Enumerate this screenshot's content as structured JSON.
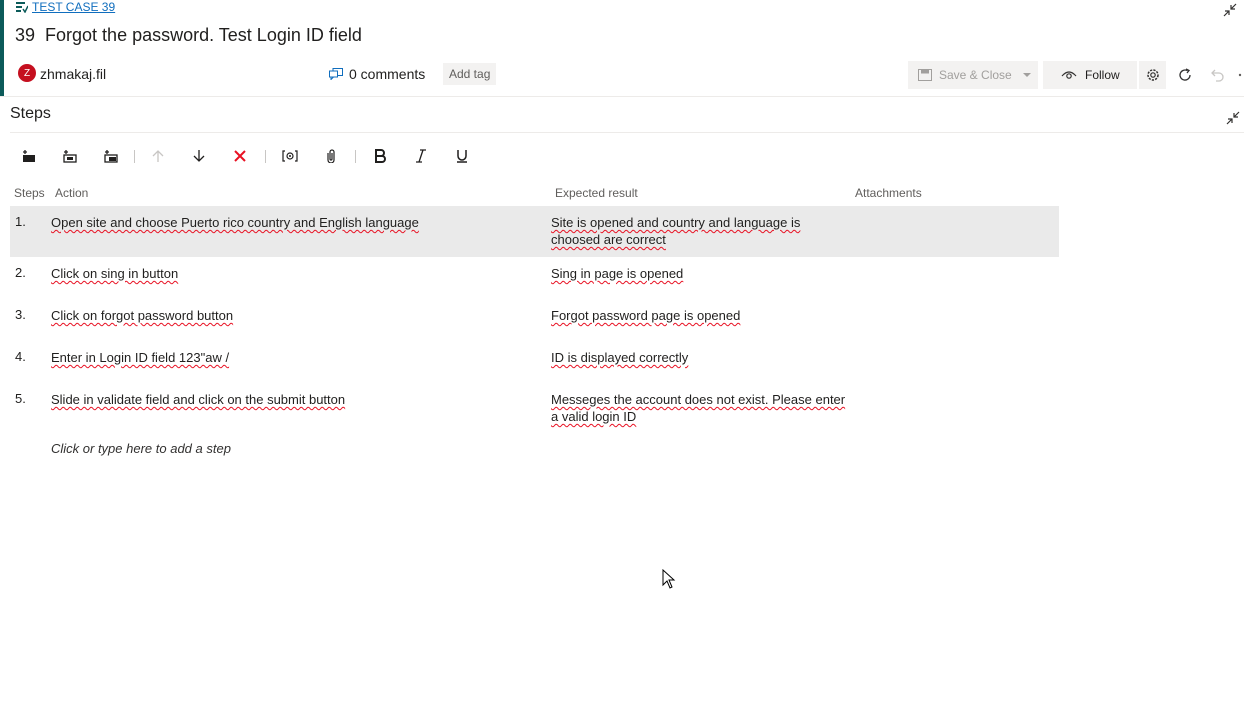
{
  "header": {
    "work_item_type": "TEST CASE 39",
    "id": "39",
    "title": "Forgot the password. Test Login ID field",
    "assigned_user": {
      "initial": "Z",
      "name": "zhmakaj.fil",
      "color": "#c50f1f"
    },
    "comments": "0 comments",
    "add_tag": "Add tag"
  },
  "toolbar": {
    "save_close": "Save & Close",
    "follow": "Follow"
  },
  "steps": {
    "heading": "Steps",
    "columns": {
      "steps": "Steps",
      "action": "Action",
      "expected": "Expected result",
      "attachments": "Attachments"
    },
    "rows": [
      {
        "num": "1.",
        "action": "Open site and choose Puerto rico country and English language",
        "expected": "Site is opened and country and language is choosed are correct"
      },
      {
        "num": "2.",
        "action": "Click on sing in button",
        "expected": "Sing in page is opened"
      },
      {
        "num": "3.",
        "action": "Click on forgot password button",
        "expected": "Forgot password page is opened"
      },
      {
        "num": "4.",
        "action": "Enter in Login ID field 123\"aw /",
        "expected": "ID is displayed correctly"
      },
      {
        "num": "5.",
        "action": "Slide in validate field and click on the submit button",
        "expected": "Messeges the account does not exist. Please enter a valid login ID"
      }
    ],
    "add_step_placeholder": "Click or type here to add a step"
  },
  "colors": {
    "accent": "#0c5b5a",
    "link": "#106ebe",
    "delete": "#e81123",
    "selected_row": "#eaeaea"
  },
  "icons": [
    "test-case-icon",
    "collapse-icon",
    "comment-icon",
    "save-icon",
    "chevron-down-icon",
    "eye-icon",
    "gear-icon",
    "refresh-icon",
    "undo-icon",
    "insert-step-icon",
    "insert-shared-step-icon",
    "create-shared-step-icon",
    "move-up-icon",
    "move-down-icon",
    "delete-icon",
    "parameter-icon",
    "attach-icon",
    "bold-icon",
    "italic-icon",
    "underline-icon",
    "mouse-cursor-icon"
  ]
}
